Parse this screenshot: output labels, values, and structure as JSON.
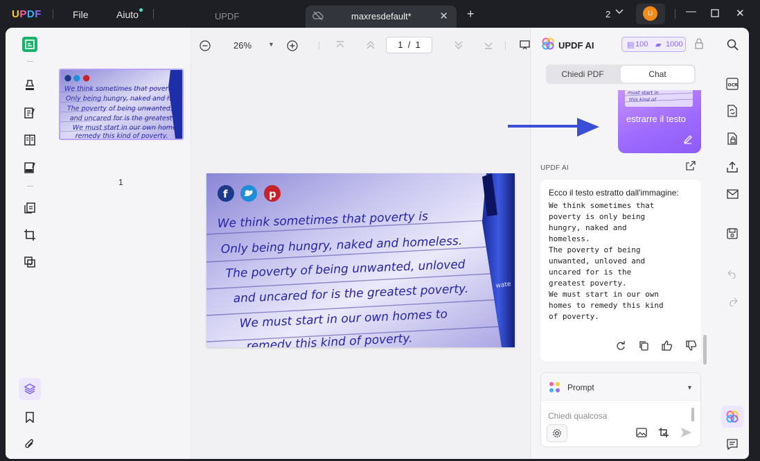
{
  "app": {
    "logo": "UPDF",
    "menu": {
      "file": "File",
      "help": "Aiuto"
    },
    "inactive_tab": "UPDF",
    "active_tab": "maxresdefault*",
    "window_count": "2",
    "avatar_initials": "Li"
  },
  "toolbar": {
    "zoom": "26%",
    "page_current": "1",
    "page_sep": "/",
    "page_total": "1"
  },
  "thumbnails": {
    "page_label": "1"
  },
  "document_image": {
    "lines": [
      "We think sometimes that poverty is",
      "Only being hungry, naked and homeless.",
      "The poverty of being unwanted, unloved",
      "and uncared for is the greatest poverty.",
      "We must start in our own homes to",
      "remedy this kind of poverty."
    ],
    "pen_text": "wate"
  },
  "ai_panel": {
    "title": "UPDF AI",
    "credits_a": "100",
    "credits_b": "1000",
    "tab_ask_pdf": "Chiedi PDF",
    "tab_chat": "Chat",
    "user_message": "estrarre il testo",
    "ai_label": "UPDF AI",
    "answer_intro": "Ecco il testo estratto dall'immagine:",
    "answer_body": "We think sometimes that\npoverty is only being\nhungry, naked and\nhomeless.\nThe poverty of being\nunwanted, unloved and\nuncared for is the\ngreatest poverty.\nWe must start in our own\nhomes to remedy this kind\nof poverty.",
    "prompt_label": "Prompt",
    "input_placeholder": "Chiedi qualcosa"
  },
  "colors": {
    "accent_green": "#19b36b",
    "ai_purple": "#8b6dff",
    "arrow_blue": "#3b4fd6"
  }
}
